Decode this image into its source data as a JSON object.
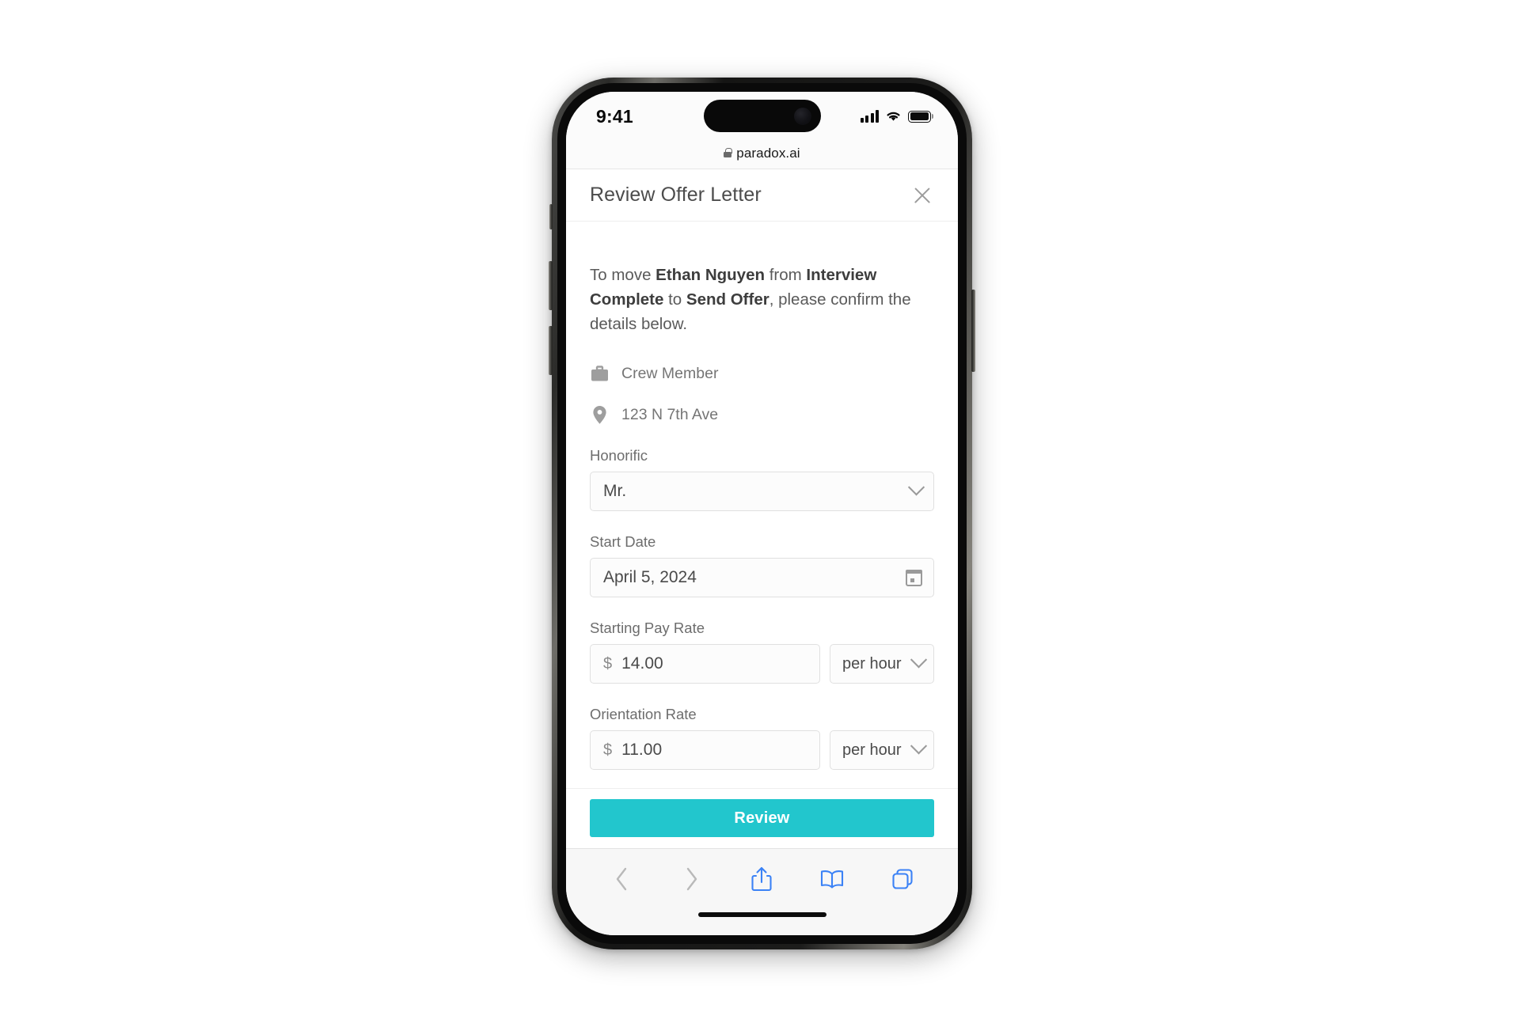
{
  "status_bar": {
    "time": "9:41",
    "cellular_icon": "cellular-signal-icon",
    "wifi_icon": "wifi-icon",
    "battery_icon": "battery-icon"
  },
  "browser": {
    "url": "paradox.ai",
    "lock_icon": "lock-icon",
    "toolbar": {
      "back_label": "back-icon",
      "forward_label": "forward-icon",
      "share_label": "share-icon",
      "bookmarks_label": "book-icon",
      "tabs_label": "tabs-icon"
    }
  },
  "sheet": {
    "title": "Review Offer Letter",
    "close_icon": "close-icon"
  },
  "intro": {
    "prefix": "To move ",
    "candidate": "Ethan Nguyen",
    "middle": " from ",
    "from_stage": "Interview Complete",
    "joiner": " to ",
    "to_stage": "Send Offer",
    "suffix": ", please confirm the details below."
  },
  "meta": [
    {
      "icon": "briefcase-icon",
      "text": "Crew Member"
    },
    {
      "icon": "location-pin-icon",
      "text": "123 N 7th Ave"
    }
  ],
  "fields": {
    "honorific": {
      "label": "Honorific",
      "value": "Mr.",
      "chevron_icon": "chevron-down-icon"
    },
    "start_date": {
      "label": "Start Date",
      "value": "April 5, 2024",
      "calendar_icon": "calendar-icon"
    },
    "starting_pay_rate": {
      "label": "Starting Pay Rate",
      "currency": "$",
      "amount": "14.00",
      "unit": "per hour",
      "chevron_icon": "chevron-down-icon"
    },
    "orientation_rate": {
      "label": "Orientation Rate",
      "currency": "$",
      "amount": "11.00",
      "unit": "per hour",
      "chevron_icon": "chevron-down-icon"
    }
  },
  "footer": {
    "primary_button": "Review"
  },
  "colors": {
    "accent": "#22c6cd",
    "safari_blue": "#3b82f6",
    "label_gray": "#6d6d6d",
    "value_gray": "#4a4a4a"
  }
}
